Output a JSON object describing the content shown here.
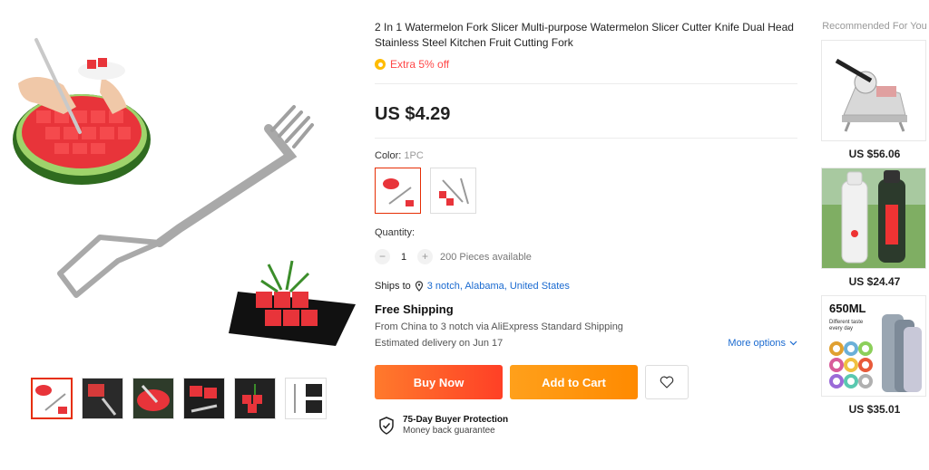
{
  "product": {
    "title": "2 In 1 Watermelon Fork Slicer Multi-purpose Watermelon Slicer Cutter Knife Dual Head Stainless Steel Kitchen Fruit Cutting Fork",
    "promo": "Extra 5% off",
    "price": "US $4.29"
  },
  "color": {
    "label": "Color:",
    "value": "1PC"
  },
  "quantity": {
    "label": "Quantity:",
    "value": "1",
    "minus": "−",
    "plus": "+",
    "available": "200 Pieces available"
  },
  "shipping": {
    "ships_to": "Ships to",
    "location": "3 notch, Alabama, United States",
    "free": "Free Shipping",
    "from_line": "From China to 3 notch via AliExpress Standard Shipping",
    "delivery": "Estimated delivery on Jun 17",
    "more_options": "More options"
  },
  "actions": {
    "buy_now": "Buy Now",
    "add_to_cart": "Add to Cart"
  },
  "protection": {
    "title": "75-Day Buyer Protection",
    "subtitle": "Money back guarantee"
  },
  "recommended": {
    "title": "Recommended For You",
    "items": [
      {
        "price": "US $56.06"
      },
      {
        "price": "US $24.47"
      },
      {
        "price": "US $35.01",
        "badge": "650ML",
        "sub": "Different taste every day"
      }
    ]
  }
}
